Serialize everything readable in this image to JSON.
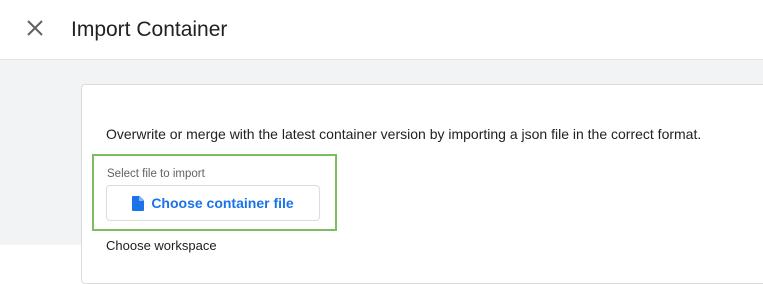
{
  "header": {
    "close_icon": "close-icon",
    "title": "Import Container"
  },
  "card": {
    "description": "Overwrite or merge with the latest container version by importing a json file in the correct format.",
    "file_select": {
      "label": "Select file to import",
      "button_label": "Choose container file",
      "button_icon": "file-icon"
    },
    "next_section_label": "Choose workspace"
  },
  "colors": {
    "accent": "#1a73e8",
    "highlight_border": "#7cbd63",
    "background": "#f1f3f4"
  }
}
